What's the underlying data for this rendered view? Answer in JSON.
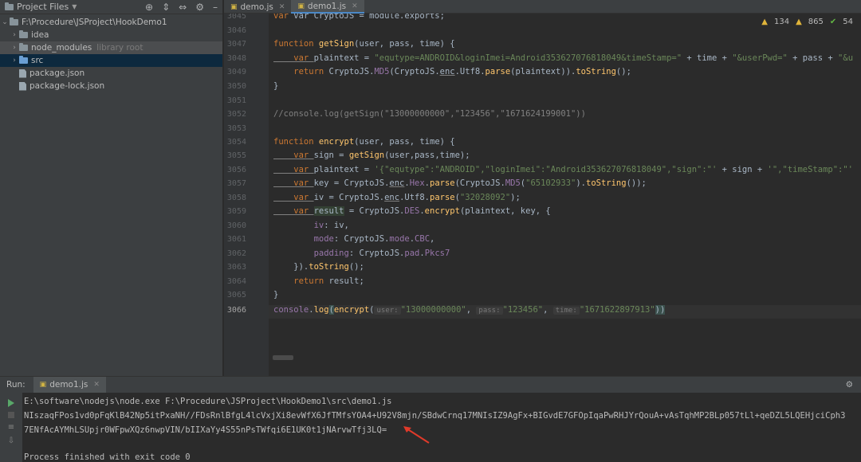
{
  "project": {
    "header": "Project Files",
    "root": "F:\\Procedure\\JSProject\\HookDemo1",
    "items": [
      {
        "label": "idea",
        "type": "folder",
        "hint": ""
      },
      {
        "label": "node_modules",
        "type": "folder",
        "hint": "library root"
      },
      {
        "label": "src",
        "type": "folder-blue",
        "hint": ""
      },
      {
        "label": "package.json",
        "type": "file",
        "hint": ""
      },
      {
        "label": "package-lock.json",
        "type": "file",
        "hint": ""
      }
    ]
  },
  "tabs": [
    {
      "label": "demo.js",
      "active": false
    },
    {
      "label": "demo1.js",
      "active": true
    }
  ],
  "inspections": {
    "warnings1": "134",
    "warnings2": "865",
    "ok": "54"
  },
  "line_numbers": [
    "3045",
    "3046",
    "3047",
    "3048",
    "3049",
    "3050",
    "3051",
    "3052",
    "3053",
    "3054",
    "3055",
    "3056",
    "3057",
    "3058",
    "3059",
    "3060",
    "3061",
    "3062",
    "3063",
    "3064",
    "3065",
    "3066"
  ],
  "code": {
    "l3045": "var CryptoJS = module.exports;",
    "l3047a": "function ",
    "l3047b": "getSign",
    "l3047c": "(user, pass, time) {",
    "l3048a": "    var ",
    "l3048b": "plaintext = ",
    "l3048c": "\"equtype=ANDROID&loginImei=Android353627076818049&timeStamp=\"",
    "l3048d": " + time + ",
    "l3048e": "\"&userPwd=\"",
    "l3048f": " + pass + ",
    "l3048g": "\"&u",
    "l3049a": "    return ",
    "l3049b": "CryptoJS.",
    "l3049c": "MD5",
    "l3049d": "(CryptoJS.",
    "l3049e": "enc",
    "l3049f": ".Utf8.",
    "l3049g": "parse",
    "l3049h": "(plaintext)).",
    "l3049i": "toString",
    "l3049j": "();",
    "l3050": "}",
    "l3052": "//console.log(getSign(\"13000000000\",\"123456\",\"1671624199001\"))",
    "l3054a": "function ",
    "l3054b": "encrypt",
    "l3054c": "(user, pass, time) {",
    "l3055a": "    var ",
    "l3055b": "sign = ",
    "l3055c": "getSign",
    "l3055d": "(user,pass,time);",
    "l3056a": "    var ",
    "l3056b": "plaintext = ",
    "l3056c": "'{\"equtype\":\"ANDROID\",\"loginImei\":\"Android353627076818049\",\"sign\":\"'",
    "l3056d": " + sign + ",
    "l3056e": "'\",\"timeStamp\":\"'",
    "l3057a": "    var ",
    "l3057b": "key = CryptoJS.",
    "l3057c": "enc",
    "l3057d": ".",
    "l3057e": "Hex",
    "l3057f": ".",
    "l3057g": "parse",
    "l3057h": "(CryptoJS.",
    "l3057i": "MD5",
    "l3057j": "(",
    "l3057k": "\"65102933\"",
    "l3057l": ").",
    "l3057m": "toString",
    "l3057n": "());",
    "l3058a": "    var ",
    "l3058b": "iv = CryptoJS.",
    "l3058c": "enc",
    "l3058d": ".Utf8.",
    "l3058e": "parse",
    "l3058f": "(",
    "l3058g": "\"32028092\"",
    "l3058h": ");",
    "l3059a": "    var ",
    "l3059b": "result",
    "l3059c": " = CryptoJS.",
    "l3059d": "DES",
    "l3059e": ".",
    "l3059f": "encrypt",
    "l3059g": "(plaintext, key, {",
    "l3060a": "        ",
    "l3060b": "iv",
    "l3060c": ": iv,",
    "l3061a": "        ",
    "l3061b": "mode",
    "l3061c": ": CryptoJS.",
    "l3061d": "mode",
    "l3061e": ".",
    "l3061f": "CBC",
    "l3061g": ",",
    "l3062a": "        ",
    "l3062b": "padding",
    "l3062c": ": CryptoJS.",
    "l3062d": "pad",
    "l3062e": ".",
    "l3062f": "Pkcs7",
    "l3063a": "    }).",
    "l3063b": "toString",
    "l3063c": "();",
    "l3064a": "    return ",
    "l3064b": "result;",
    "l3065": "}",
    "l3066a": "console",
    "l3066b": ".",
    "l3066c": "log",
    "l3066d": "(",
    "l3066e": "encrypt",
    "l3066f": "(",
    "hint_user": "user:",
    "arg_user": "\"13000000000\"",
    "comma1": ", ",
    "hint_pass": "pass:",
    "arg_pass": "\"123456\"",
    "comma2": ", ",
    "hint_time": "time:",
    "arg_time": "\"1671622897913\"",
    "l3066g": "))"
  },
  "run": {
    "label": "Run:",
    "tab": "demo1.js",
    "cmd": "E:\\software\\nodejs\\node.exe F:\\Procedure\\JSProject\\HookDemo1\\src\\demo1.js",
    "out1": "NIszaqFPos1vd0pFqKlB42Np5itPxaNH//FDsRnlBfgL4lcVxjXi8evWfX6JfTMfsYOA4+U92V8mjn/SBdwCrnq17MNIsIZ9AgFx+BIGvdE7GFOpIqaPwRHJYrQouA+vAsTqhMP2BLp057tLl+qeDZL5LQEHjciCph3",
    "out2": "7ENfAcAYMhLSUpjr0WFpwXQz6nwpVIN/bIIXaYy4S55nPsTWfqi6E1UK0t1jNArvwTfj3LQ=",
    "exit": "Process finished with exit code 0"
  }
}
